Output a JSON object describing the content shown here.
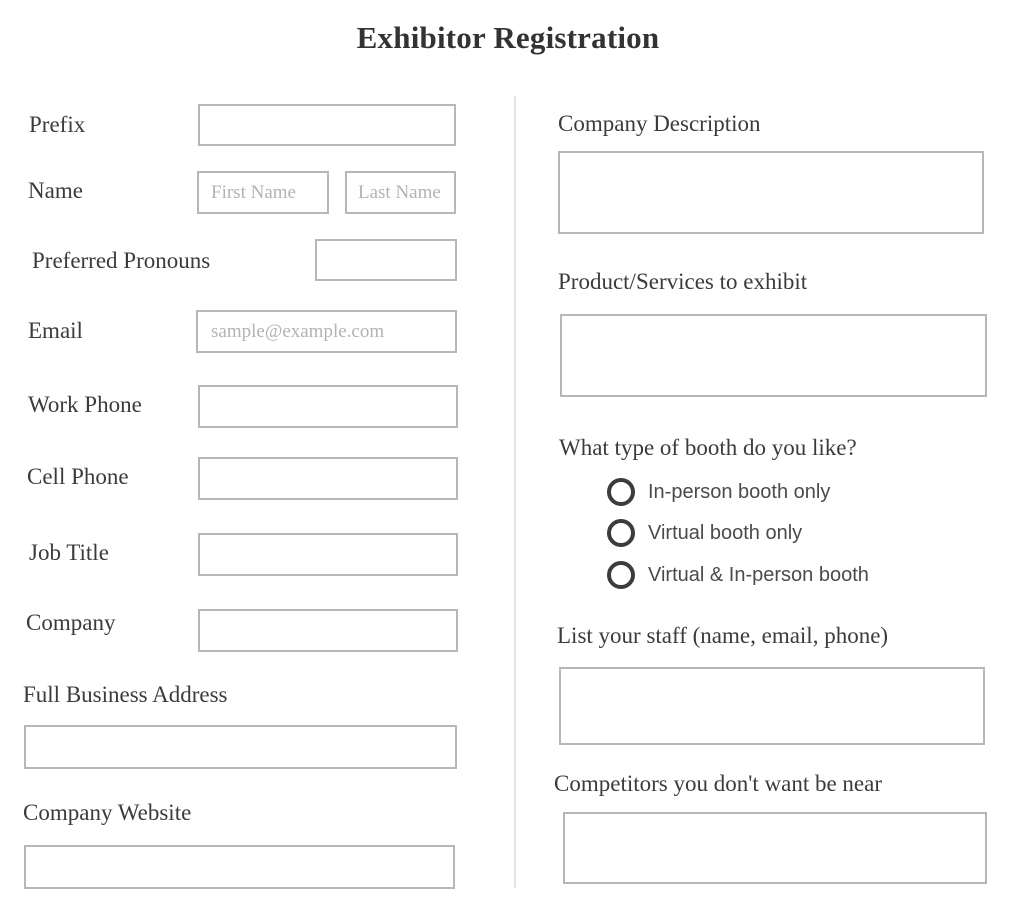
{
  "page": {
    "title": "Exhibitor Registration",
    "background_color": "#ffffff",
    "text_color": "#3a3a3a",
    "field_border_color": "#b7b7b7",
    "placeholder_color": "#b3b3b3",
    "divider_color": "#e4e4e4",
    "radio_color": "#3c3c3c"
  },
  "left_column": {
    "fields": [
      {
        "label": "Prefix",
        "value": "",
        "placeholder": ""
      },
      {
        "label": "Name",
        "value": "",
        "placeholder": ""
      },
      {
        "label": "Preferred Pronouns",
        "value": "",
        "placeholder": ""
      },
      {
        "label": "Email",
        "value": "",
        "placeholder": "sample@example.com"
      },
      {
        "label": "Work Phone",
        "value": "",
        "placeholder": ""
      },
      {
        "label": "Cell Phone",
        "value": "",
        "placeholder": ""
      },
      {
        "label": "Job Title",
        "value": "",
        "placeholder": ""
      },
      {
        "label": "Company",
        "value": "",
        "placeholder": ""
      },
      {
        "label": "Full Business Address",
        "value": "",
        "placeholder": ""
      },
      {
        "label": "Company Website",
        "value": "",
        "placeholder": ""
      }
    ],
    "name_field": {
      "first_name_placeholder": "First Name",
      "first_name_value": "",
      "last_name_placeholder": "Last Name",
      "last_name_value": ""
    }
  },
  "right_column": {
    "fields": [
      {
        "label": "Company Description",
        "value": "",
        "placeholder": ""
      },
      {
        "label": "Product/Services to exhibit",
        "value": "",
        "placeholder": ""
      },
      {
        "label": "List your staff (name, email, phone)",
        "value": "",
        "placeholder": ""
      },
      {
        "label": "Competitors you don't want be near",
        "value": "",
        "placeholder": ""
      }
    ],
    "booth_question": {
      "label": "What type of booth do you like?",
      "selected": "",
      "options": [
        {
          "label": "In-person booth only",
          "checked": false
        },
        {
          "label": "Virtual booth only",
          "checked": false
        },
        {
          "label": "Virtual & In-person booth",
          "checked": false
        }
      ]
    }
  }
}
